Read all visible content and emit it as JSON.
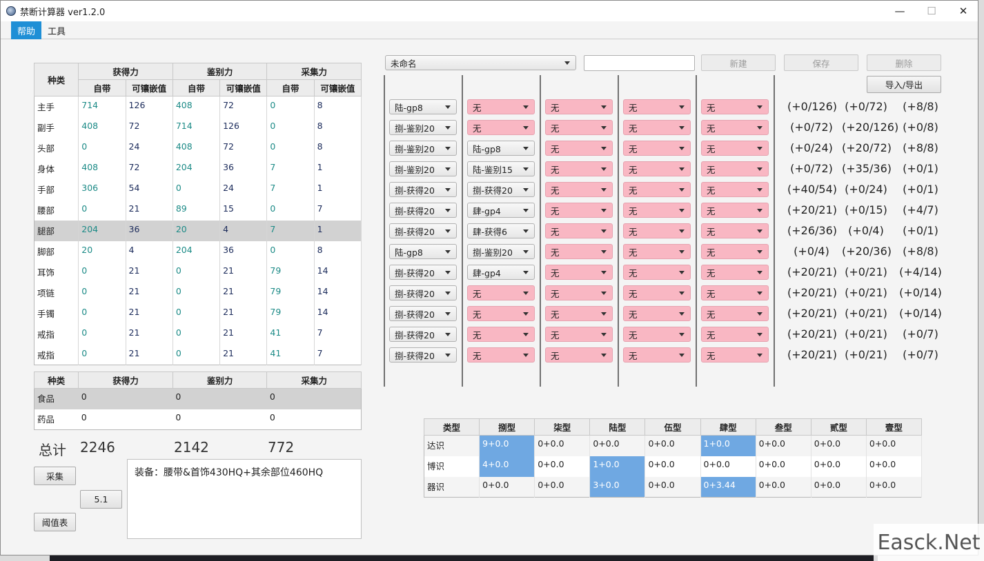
{
  "window": {
    "title": "禁断计算器 ver1.2.0",
    "minimize": "—",
    "maximize": "☐",
    "close": "✕"
  },
  "menu": [
    "帮助",
    "工具"
  ],
  "gear_table": {
    "header_category": "种类",
    "groups": [
      "获得力",
      "鉴别力",
      "采集力"
    ],
    "subcols": [
      "自带",
      "可镶嵌值",
      "自带",
      "可镶嵌值",
      "自带",
      "可镶嵌值"
    ],
    "rows": [
      {
        "name": "主手",
        "v": [
          "714",
          "126",
          "408",
          "72",
          "0",
          "8"
        ]
      },
      {
        "name": "副手",
        "v": [
          "408",
          "72",
          "714",
          "126",
          "0",
          "8"
        ]
      },
      {
        "name": "头部",
        "v": [
          "0",
          "24",
          "408",
          "72",
          "0",
          "8"
        ]
      },
      {
        "name": "身体",
        "v": [
          "408",
          "72",
          "204",
          "36",
          "7",
          "1"
        ]
      },
      {
        "name": "手部",
        "v": [
          "306",
          "54",
          "0",
          "24",
          "7",
          "1"
        ]
      },
      {
        "name": "腰部",
        "v": [
          "0",
          "21",
          "89",
          "15",
          "0",
          "7"
        ]
      },
      {
        "name": "腿部",
        "v": [
          "204",
          "36",
          "20",
          "4",
          "7",
          "1"
        ]
      },
      {
        "name": "脚部",
        "v": [
          "20",
          "4",
          "204",
          "36",
          "0",
          "8"
        ]
      },
      {
        "name": "耳饰",
        "v": [
          "0",
          "21",
          "0",
          "21",
          "79",
          "14"
        ]
      },
      {
        "name": "项链",
        "v": [
          "0",
          "21",
          "0",
          "21",
          "79",
          "14"
        ]
      },
      {
        "name": "手镯",
        "v": [
          "0",
          "21",
          "0",
          "21",
          "79",
          "14"
        ]
      },
      {
        "name": "戒指",
        "v": [
          "0",
          "21",
          "0",
          "21",
          "41",
          "7"
        ]
      },
      {
        "name": "戒指",
        "v": [
          "0",
          "21",
          "0",
          "21",
          "41",
          "7"
        ]
      }
    ]
  },
  "food_table": {
    "headers": [
      "种类",
      "获得力",
      "鉴别力",
      "采集力"
    ],
    "rows": [
      {
        "name": "食品",
        "v": [
          "0",
          "0",
          "0"
        ]
      },
      {
        "name": "药品",
        "v": [
          "0",
          "0",
          "0"
        ]
      }
    ]
  },
  "totals": {
    "label": "总计",
    "gathering": "2246",
    "perception": "2142",
    "gp": "772"
  },
  "buttons": {
    "collect": "采集",
    "version": "5.1",
    "threshold": "阈值表",
    "new": "新建",
    "save": "保存",
    "delete": "删除",
    "import_export": "导入/导出"
  },
  "note": "装备：腰带&首饰430HQ+其余部位460HQ",
  "preset": {
    "name": "未命名",
    "input_value": ""
  },
  "meld_rows": [
    {
      "m": [
        "陆-gp8",
        "无",
        "无",
        "无",
        "无"
      ],
      "r": [
        "(+0/126)",
        "(+0/72)",
        "(+8/8)"
      ]
    },
    {
      "m": [
        "捌-鉴别20",
        "无",
        "无",
        "无",
        "无"
      ],
      "r": [
        "(+0/72)",
        "(+20/126)",
        "(+0/8)"
      ]
    },
    {
      "m": [
        "捌-鉴别20",
        "陆-gp8",
        "无",
        "无",
        "无"
      ],
      "r": [
        "(+0/24)",
        "(+20/72)",
        "(+8/8)"
      ]
    },
    {
      "m": [
        "捌-鉴别20",
        "陆-鉴别15",
        "无",
        "无",
        "无"
      ],
      "r": [
        "(+0/72)",
        "(+35/36)",
        "(+0/1)"
      ]
    },
    {
      "m": [
        "捌-获得20",
        "捌-获得20",
        "无",
        "无",
        "无"
      ],
      "r": [
        "(+40/54)",
        "(+0/24)",
        "(+0/1)"
      ]
    },
    {
      "m": [
        "捌-获得20",
        "肆-gp4",
        "无",
        "无",
        "无"
      ],
      "r": [
        "(+20/21)",
        "(+0/15)",
        "(+4/7)"
      ]
    },
    {
      "m": [
        "捌-获得20",
        "肆-获得6",
        "无",
        "无",
        "无"
      ],
      "r": [
        "(+26/36)",
        "(+0/4)",
        "(+0/1)"
      ]
    },
    {
      "m": [
        "陆-gp8",
        "捌-鉴别20",
        "无",
        "无",
        "无"
      ],
      "r": [
        "(+0/4)",
        "(+20/36)",
        "(+8/8)"
      ]
    },
    {
      "m": [
        "捌-获得20",
        "肆-gp4",
        "无",
        "无",
        "无"
      ],
      "r": [
        "(+20/21)",
        "(+0/21)",
        "(+4/14)"
      ]
    },
    {
      "m": [
        "捌-获得20",
        "无",
        "无",
        "无",
        "无"
      ],
      "r": [
        "(+20/21)",
        "(+0/21)",
        "(+0/14)"
      ]
    },
    {
      "m": [
        "捌-获得20",
        "无",
        "无",
        "无",
        "无"
      ],
      "r": [
        "(+20/21)",
        "(+0/21)",
        "(+0/14)"
      ]
    },
    {
      "m": [
        "捌-获得20",
        "无",
        "无",
        "无",
        "无"
      ],
      "r": [
        "(+20/21)",
        "(+0/21)",
        "(+0/7)"
      ]
    },
    {
      "m": [
        "捌-获得20",
        "无",
        "无",
        "无",
        "无"
      ],
      "r": [
        "(+20/21)",
        "(+0/21)",
        "(+0/7)"
      ]
    }
  ],
  "materia_table": {
    "headers": [
      "类型",
      "捌型",
      "柒型",
      "陆型",
      "伍型",
      "肆型",
      "叁型",
      "贰型",
      "壹型"
    ],
    "rows": [
      {
        "name": "达识",
        "v": [
          "9+0.0",
          "0+0.0",
          "0+0.0",
          "0+0.0",
          "1+0.0",
          "0+0.0",
          "0+0.0",
          "0+0.0"
        ],
        "hl": [
          0,
          4
        ]
      },
      {
        "name": "博识",
        "v": [
          "4+0.0",
          "0+0.0",
          "1+0.0",
          "0+0.0",
          "0+0.0",
          "0+0.0",
          "0+0.0",
          "0+0.0"
        ],
        "hl": [
          0,
          2
        ]
      },
      {
        "name": "器识",
        "v": [
          "0+0.0",
          "0+0.0",
          "3+0.0",
          "0+0.0",
          "0+3.44",
          "0+0.0",
          "0+0.0",
          "0+0.0"
        ],
        "hl": [
          2,
          4
        ]
      }
    ]
  },
  "watermark": "Easck.Net",
  "colors": {
    "accent": "#1f8fd6",
    "pink": "#f9b7c3",
    "highlight": "#6fa8e2",
    "teal": "#1b8a86"
  }
}
